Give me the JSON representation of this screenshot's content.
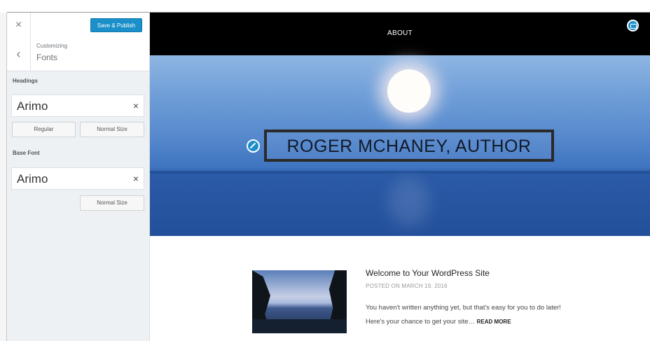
{
  "sidebar": {
    "close_label": "×",
    "publish_label": "Save & Publish",
    "back_label": "‹",
    "breadcrumb": "Customizing",
    "section_title": "Fonts",
    "headings": {
      "label": "Headings",
      "font": "Arimo",
      "clear": "×",
      "weight": "Regular",
      "size": "Normal Size"
    },
    "base_font": {
      "label": "Base Font",
      "font": "Arimo",
      "clear": "×",
      "size": "Normal Size"
    }
  },
  "preview": {
    "nav_item": "ABOUT",
    "site_title": "ROGER MCHANEY, AUTHOR",
    "post": {
      "title": "Welcome to Your WordPress Site",
      "meta": "POSTED ON MARCH 19, 2016",
      "excerpt": "You haven't written anything yet, but that's easy for you to do later! Here's your chance to get your site…",
      "read_more": "READ MORE"
    }
  },
  "colors": {
    "accent": "#1a8fc9",
    "nav_background": "#000000",
    "sidebar_background": "#eef1f4"
  },
  "icons": {
    "close": "close-icon",
    "back": "chevron-left-icon",
    "header_image_edit": "image-edit-icon",
    "title_edit": "pencil-icon"
  }
}
